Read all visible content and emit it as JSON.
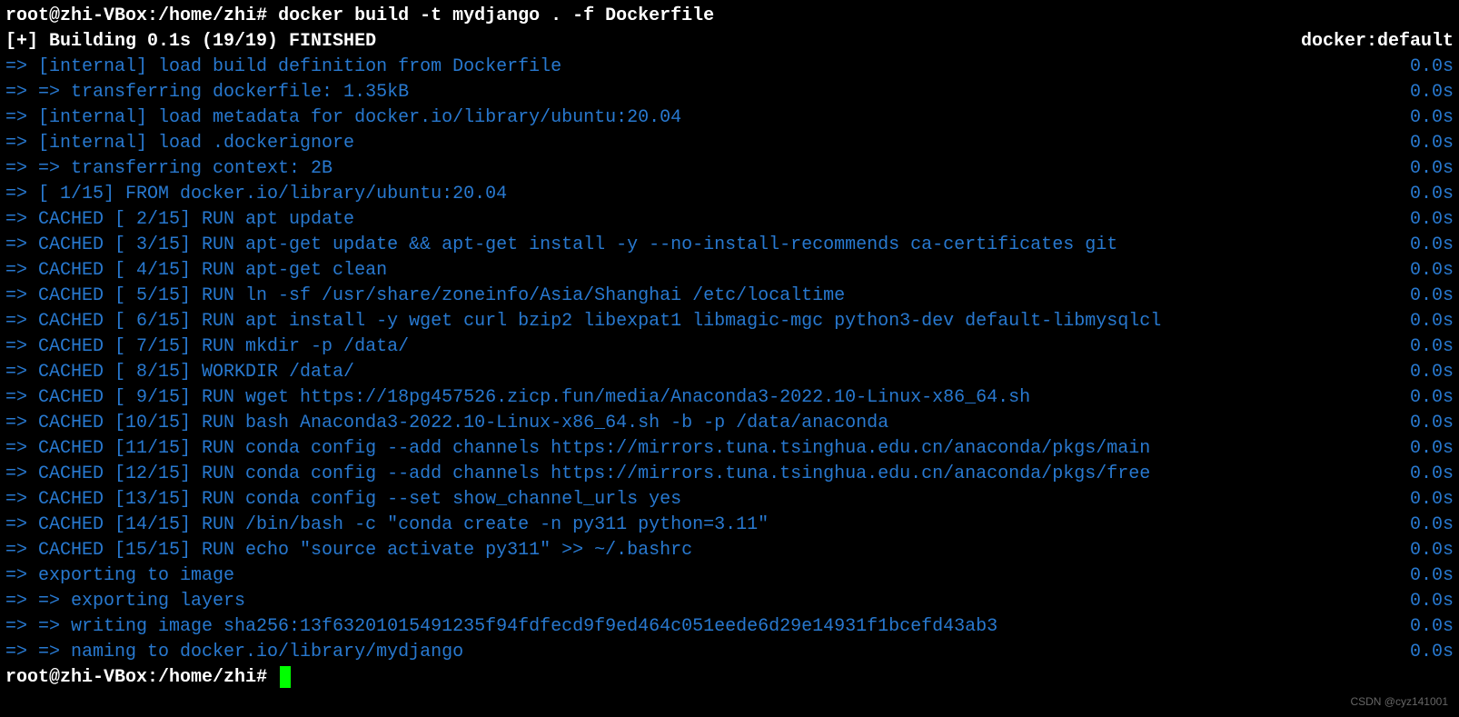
{
  "prompt1": {
    "user_host": "root@zhi-VBox",
    "path": "/home/zhi",
    "symbol": "#",
    "command": "docker build -t mydjango . -f Dockerfile"
  },
  "status": {
    "left": "[+] Building 0.1s (19/19) FINISHED",
    "right": "docker:default"
  },
  "lines": [
    {
      "text": "=> [internal] load build definition from Dockerfile",
      "dur": "0.0s"
    },
    {
      "text": "=> => transferring dockerfile: 1.35kB",
      "dur": "0.0s"
    },
    {
      "text": "=> [internal] load metadata for docker.io/library/ubuntu:20.04",
      "dur": "0.0s"
    },
    {
      "text": "=> [internal] load .dockerignore",
      "dur": "0.0s"
    },
    {
      "text": "=> => transferring context: 2B",
      "dur": "0.0s"
    },
    {
      "text": "=> [ 1/15] FROM docker.io/library/ubuntu:20.04",
      "dur": "0.0s"
    },
    {
      "text": "=> CACHED [ 2/15] RUN apt update",
      "dur": "0.0s"
    },
    {
      "text": "=> CACHED [ 3/15] RUN apt-get update && apt-get install -y --no-install-recommends ca-certificates git",
      "dur": "0.0s"
    },
    {
      "text": "=> CACHED [ 4/15] RUN apt-get clean",
      "dur": "0.0s"
    },
    {
      "text": "=> CACHED [ 5/15] RUN ln -sf /usr/share/zoneinfo/Asia/Shanghai /etc/localtime",
      "dur": "0.0s"
    },
    {
      "text": "=> CACHED [ 6/15] RUN apt install -y wget curl bzip2 libexpat1 libmagic-mgc python3-dev default-libmysqlcl",
      "dur": "0.0s"
    },
    {
      "text": "=> CACHED [ 7/15] RUN mkdir -p /data/",
      "dur": "0.0s"
    },
    {
      "text": "=> CACHED [ 8/15] WORKDIR /data/",
      "dur": "0.0s"
    },
    {
      "text": "=> CACHED [ 9/15] RUN wget https://18pg457526.zicp.fun/media/Anaconda3-2022.10-Linux-x86_64.sh",
      "dur": "0.0s"
    },
    {
      "text": "=> CACHED [10/15] RUN bash Anaconda3-2022.10-Linux-x86_64.sh -b -p /data/anaconda",
      "dur": "0.0s"
    },
    {
      "text": "=> CACHED [11/15] RUN conda config --add channels https://mirrors.tuna.tsinghua.edu.cn/anaconda/pkgs/main",
      "dur": "0.0s"
    },
    {
      "text": "=> CACHED [12/15] RUN conda config --add channels https://mirrors.tuna.tsinghua.edu.cn/anaconda/pkgs/free",
      "dur": "0.0s"
    },
    {
      "text": "=> CACHED [13/15] RUN conda config --set show_channel_urls yes",
      "dur": "0.0s"
    },
    {
      "text": "=> CACHED [14/15] RUN /bin/bash -c \"conda create -n py311 python=3.11\"",
      "dur": "0.0s"
    },
    {
      "text": "=> CACHED [15/15] RUN echo \"source activate py311\" >> ~/.bashrc",
      "dur": "0.0s"
    },
    {
      "text": "=> exporting to image",
      "dur": "0.0s"
    },
    {
      "text": "=> => exporting layers",
      "dur": "0.0s"
    },
    {
      "text": "=> => writing image sha256:13f63201015491235f94fdfecd9f9ed464c051eede6d29e14931f1bcefd43ab3",
      "dur": "0.0s"
    },
    {
      "text": "=> => naming to docker.io/library/mydjango",
      "dur": "0.0s"
    }
  ],
  "prompt2": {
    "user_host": "root@zhi-VBox",
    "path": "/home/zhi",
    "symbol": "#"
  },
  "watermark": "CSDN @cyz141001"
}
